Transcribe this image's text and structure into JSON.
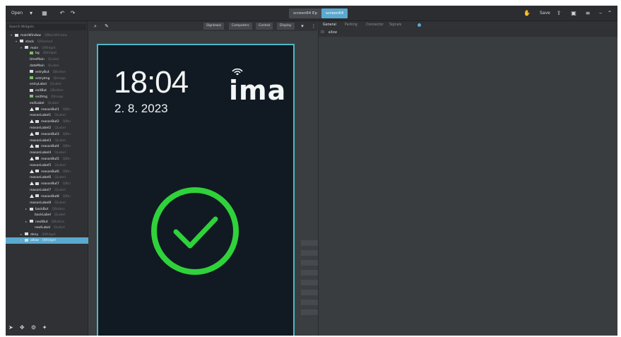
{
  "toolbar": {
    "open_label": "Open",
    "chevron": "▾",
    "icons": [
      "layout-icon",
      "undo-icon",
      "redo-icon"
    ],
    "file_tabs": [
      {
        "label": "screen64 Ep",
        "active": false
      },
      {
        "label": "screen64",
        "active": true
      }
    ],
    "save_label": "Save"
  },
  "navigator": {
    "search_placeholder": "Search Widgets",
    "tree": [
      {
        "label": "mainWindow",
        "type": "QMainWindow",
        "indent": 1,
        "icon": "node",
        "arrow": "▾"
      },
      {
        "label": "stack",
        "type": "QStacked",
        "indent": 2,
        "icon": "node",
        "arrow": "▾"
      },
      {
        "label": "main",
        "type": "QWidget",
        "indent": 3,
        "icon": "node",
        "arrow": "▾"
      },
      {
        "label": "bg",
        "type": "QWidget",
        "indent": 4,
        "icon": "img"
      },
      {
        "label": "timeMain",
        "type": "QLabel",
        "indent": 4,
        "icon": "none"
      },
      {
        "label": "dateMain",
        "type": "QLabel",
        "indent": 4,
        "icon": "none"
      },
      {
        "label": "entryBut",
        "type": "QButton",
        "indent": 4,
        "icon": "node"
      },
      {
        "label": "entryImg",
        "type": "QImage",
        "indent": 4,
        "icon": "img"
      },
      {
        "label": "entryLabel",
        "type": "QLabel",
        "indent": 4,
        "icon": "none"
      },
      {
        "label": "exitBut",
        "type": "QButton",
        "indent": 4,
        "icon": "node"
      },
      {
        "label": "exitImg",
        "type": "QImage",
        "indent": 4,
        "icon": "img"
      },
      {
        "label": "exitLabel",
        "type": "QLabel",
        "indent": 4,
        "icon": "none"
      },
      {
        "label": "reasonBut1",
        "type": "QBtn",
        "indent": 4,
        "icon": "warn"
      },
      {
        "label": "reasonLabel1",
        "type": "QLabel",
        "indent": 4,
        "icon": "none"
      },
      {
        "label": "reasonBut2",
        "type": "QBtn",
        "indent": 4,
        "icon": "warn"
      },
      {
        "label": "reasonLabel2",
        "type": "QLabel",
        "indent": 4,
        "icon": "none"
      },
      {
        "label": "reasonBut3",
        "type": "QBtn",
        "indent": 4,
        "icon": "warn"
      },
      {
        "label": "reasonLabel3",
        "type": "QLabel",
        "indent": 4,
        "icon": "none"
      },
      {
        "label": "reasonBut4",
        "type": "QBtn",
        "indent": 4,
        "icon": "warn"
      },
      {
        "label": "reasonLabel4",
        "type": "QLabel",
        "indent": 4,
        "icon": "none"
      },
      {
        "label": "reasonBut5",
        "type": "QBtn",
        "indent": 4,
        "icon": "warn"
      },
      {
        "label": "reasonLabel5",
        "type": "QLabel",
        "indent": 4,
        "icon": "none"
      },
      {
        "label": "reasonBut6",
        "type": "QBtn",
        "indent": 4,
        "icon": "warn"
      },
      {
        "label": "reasonLabel6",
        "type": "QLabel",
        "indent": 4,
        "icon": "none"
      },
      {
        "label": "reasonBut7",
        "type": "QBtn",
        "indent": 4,
        "icon": "warn"
      },
      {
        "label": "reasonLabel7",
        "type": "QLabel",
        "indent": 4,
        "icon": "none"
      },
      {
        "label": "reasonBut8",
        "type": "QBtn",
        "indent": 4,
        "icon": "warn"
      },
      {
        "label": "reasonLabel8",
        "type": "QLabel",
        "indent": 4,
        "icon": "none"
      },
      {
        "label": "backBut",
        "type": "QButton",
        "indent": 4,
        "icon": "node",
        "arrow": "▸"
      },
      {
        "label": "backLabel",
        "type": "QLabel",
        "indent": 5,
        "icon": "none"
      },
      {
        "label": "nextBut",
        "type": "QButton",
        "indent": 4,
        "icon": "node",
        "arrow": "▸"
      },
      {
        "label": "nextLabel",
        "type": "QLabel",
        "indent": 5,
        "icon": "none"
      },
      {
        "label": "deny",
        "type": "QWidget",
        "indent": 3,
        "icon": "node",
        "arrow": "▸"
      },
      {
        "label": "allow",
        "type": "QWidget",
        "indent": 3,
        "icon": "node",
        "arrow": "▸",
        "selected": true
      }
    ]
  },
  "editor": {
    "buttons": [
      "Slgnlewis",
      "Compoters",
      "Control",
      "Display"
    ]
  },
  "device": {
    "time": "18:04",
    "date": "2. 8. 2023",
    "brand": "ima",
    "accent_color": "#2fd23a",
    "border_color": "#4eb7c6"
  },
  "properties": {
    "tabs": [
      {
        "label": "General",
        "active": true
      },
      {
        "label": "Parking",
        "active": false
      },
      {
        "label": "Connector",
        "active": false
      },
      {
        "label": "Signals",
        "active": false
      }
    ],
    "row_label": "allow"
  }
}
